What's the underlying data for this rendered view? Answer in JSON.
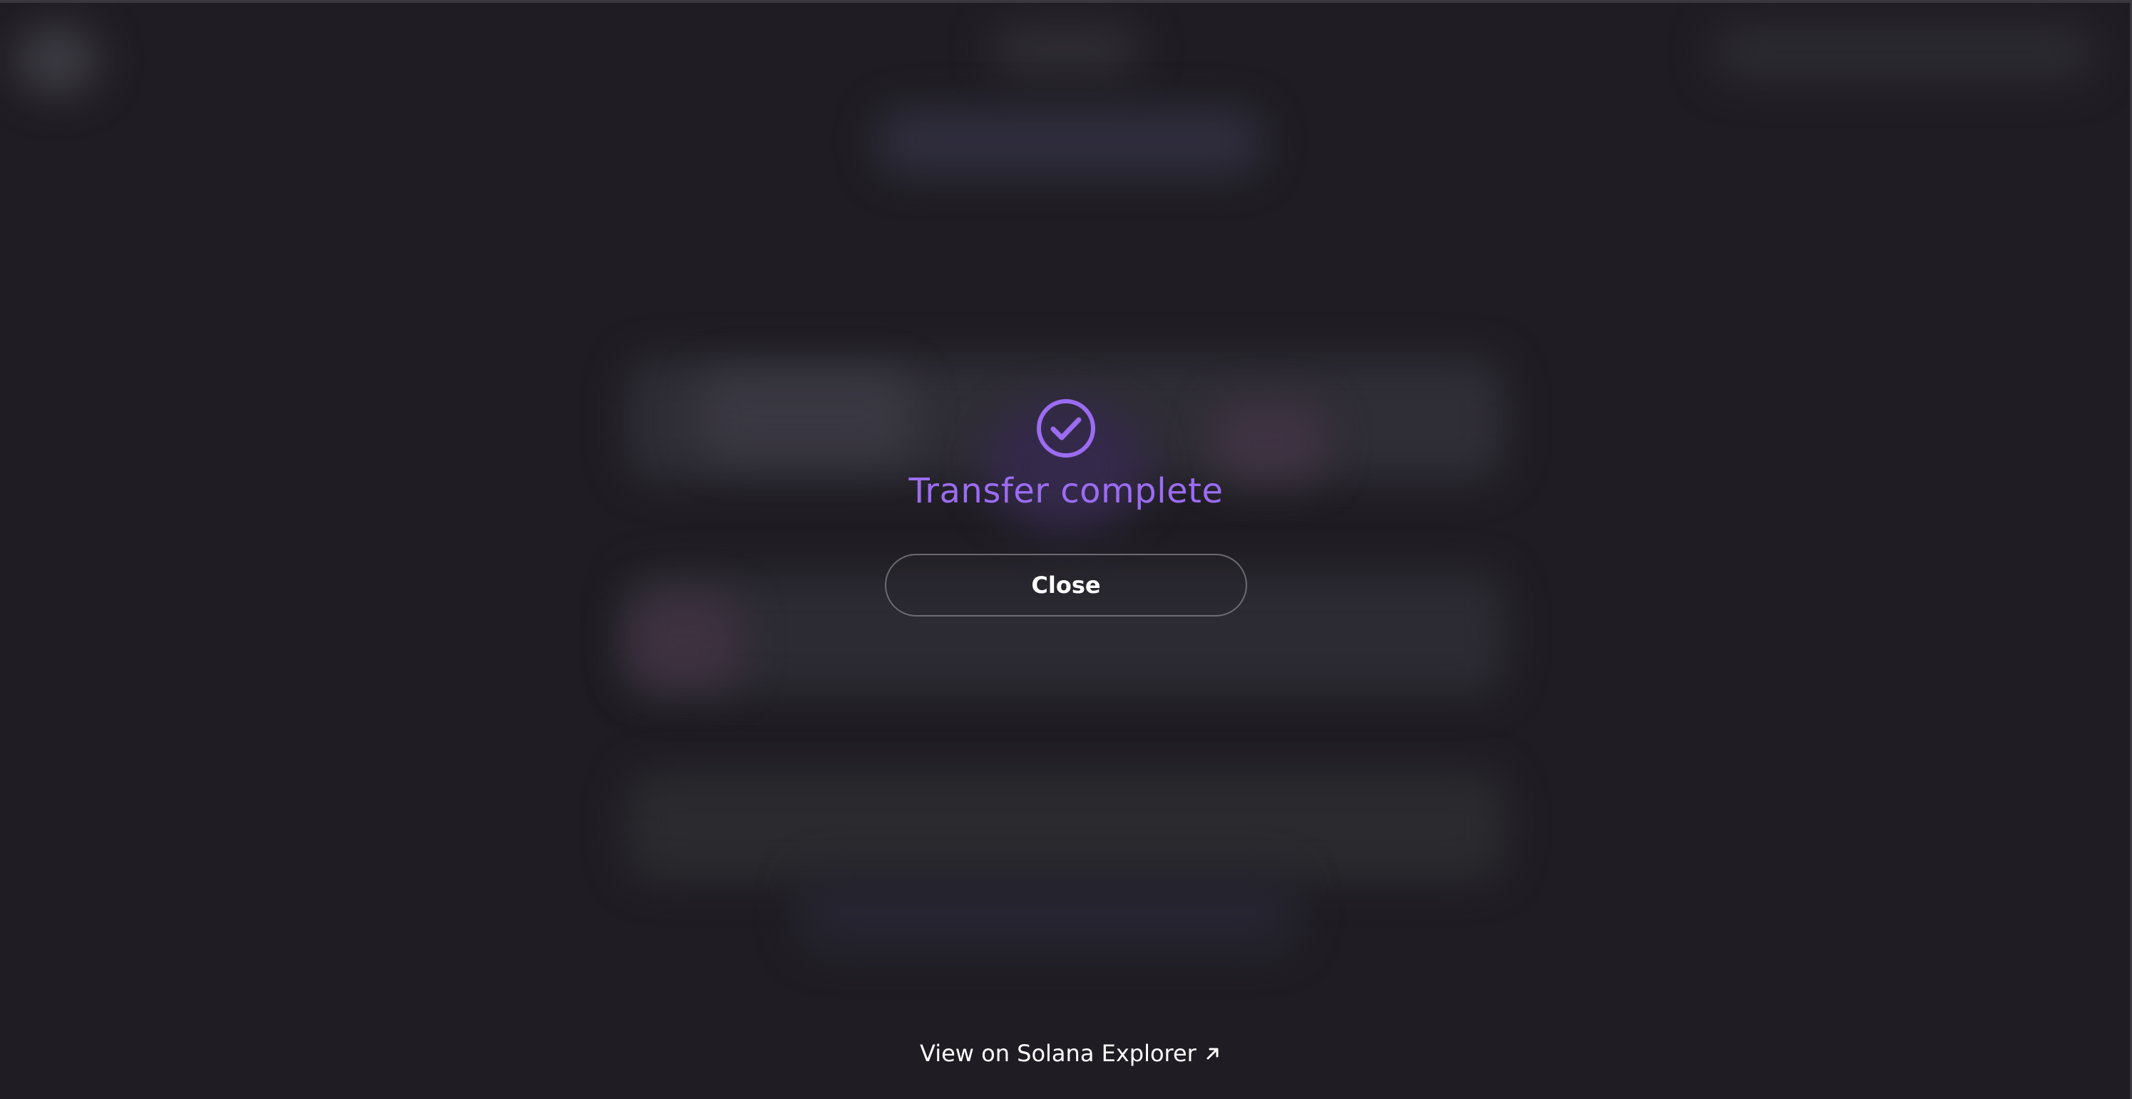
{
  "modal": {
    "title": "Transfer complete",
    "close_label": "Close",
    "accent_color": "#9b6cf2"
  },
  "footer": {
    "explorer_link_label": "View on Solana Explorer"
  },
  "icons": {
    "status": "check-circle-icon",
    "link": "arrow-up-right-icon"
  }
}
